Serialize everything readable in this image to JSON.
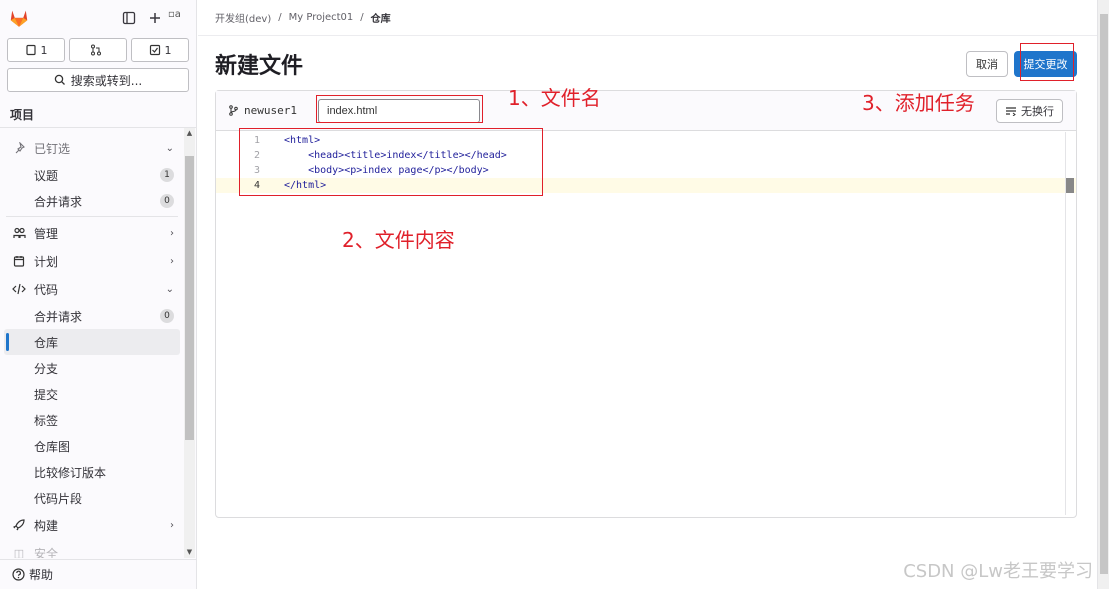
{
  "sidebar": {
    "counts": {
      "issues": "1",
      "merge_requests": "",
      "todos": "1"
    },
    "avatar_alt": "a",
    "search_label": "搜索或转到...",
    "section_title": "项目",
    "pinned": {
      "label": "已钉选",
      "items": [
        {
          "label": "议题",
          "badge": "1"
        },
        {
          "label": "合并请求",
          "badge": "0"
        }
      ]
    },
    "manage": "管理",
    "plan": "计划",
    "code": {
      "label": "代码",
      "items": [
        {
          "label": "合并请求",
          "badge": "0"
        },
        {
          "label": "仓库"
        },
        {
          "label": "分支"
        },
        {
          "label": "提交"
        },
        {
          "label": "标签"
        },
        {
          "label": "仓库图"
        },
        {
          "label": "比较修订版本"
        },
        {
          "label": "代码片段"
        }
      ]
    },
    "build": "构建",
    "partial": "安全",
    "help": "帮助"
  },
  "breadcrumb": {
    "group": "开发组(dev)",
    "project": "My Project01",
    "current": "仓库"
  },
  "page_title": "新建文件",
  "buttons": {
    "cancel": "取消",
    "commit": "提交更改",
    "no_wrap": "无换行"
  },
  "editor": {
    "branch": "newuser1",
    "filename": "index.html",
    "lines": [
      {
        "n": "1",
        "text": "<html>"
      },
      {
        "n": "2",
        "text": "    <head><title>index</title></head>"
      },
      {
        "n": "3",
        "text": "    <body><p>index page</p></body>"
      },
      {
        "n": "4",
        "text": "</html>"
      }
    ]
  },
  "annotations": {
    "a1": "1、文件名",
    "a2": "2、文件内容",
    "a3": "3、添加任务"
  },
  "watermark": "CSDN @Lw老王要学习",
  "colors": {
    "accent": "#1f75cb",
    "annotation": "#e0202a"
  }
}
